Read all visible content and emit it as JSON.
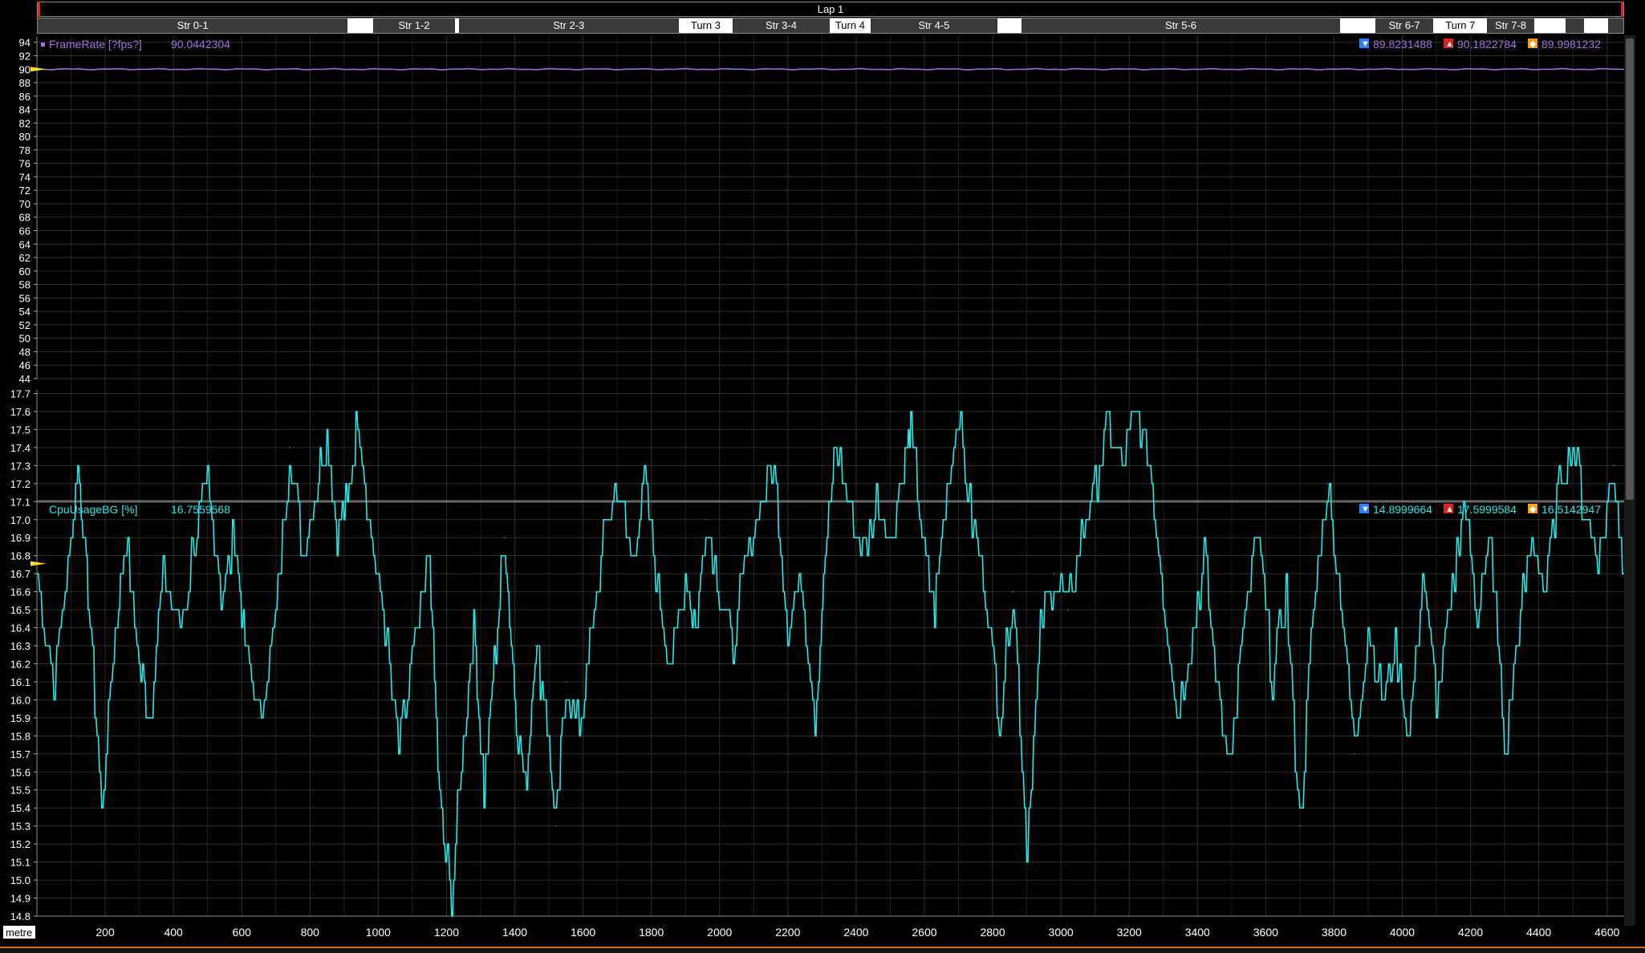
{
  "lap": {
    "title": "Lap 1"
  },
  "sectors": [
    {
      "label": "Str 0-1",
      "start": 0,
      "end": 832,
      "style": "dark"
    },
    {
      "label": "",
      "start": 832,
      "end": 900,
      "style": "light"
    },
    {
      "label": "Str 1-2",
      "start": 900,
      "end": 1120,
      "style": "dark"
    },
    {
      "label": "Str 2-3",
      "start": 1130,
      "end": 1720,
      "style": "dark"
    },
    {
      "label": "Turn 3",
      "start": 1720,
      "end": 1865,
      "style": "light"
    },
    {
      "label": "Str 3-4",
      "start": 1865,
      "end": 2125,
      "style": "dark"
    },
    {
      "label": "Turn 4",
      "start": 2125,
      "end": 2235,
      "style": "light"
    },
    {
      "label": "Str 4-5",
      "start": 2235,
      "end": 2575,
      "style": "dark"
    },
    {
      "label": "",
      "start": 2575,
      "end": 2640,
      "style": "light"
    },
    {
      "label": "Str 5-6",
      "start": 2640,
      "end": 3495,
      "style": "dark"
    },
    {
      "label": "",
      "start": 3495,
      "end": 3590,
      "style": "light"
    },
    {
      "label": "Str 6-7",
      "start": 3590,
      "end": 3745,
      "style": "dark"
    },
    {
      "label": "Turn 7",
      "start": 3745,
      "end": 3890,
      "style": "light"
    },
    {
      "label": "Str 7-8",
      "start": 3890,
      "end": 4015,
      "style": "dark"
    },
    {
      "label": "",
      "start": 4015,
      "end": 4100,
      "style": "light"
    },
    {
      "label": "",
      "start": 4100,
      "end": 4150,
      "style": "dark"
    },
    {
      "label": "",
      "start": 4150,
      "end": 4215,
      "style": "light"
    },
    {
      "label": "",
      "start": 4215,
      "end": 4255,
      "style": "dark"
    }
  ],
  "chart_data": [
    {
      "type": "line",
      "series": [
        {
          "name": "FrameRate [?fps?]",
          "color": "#a070e0"
        }
      ],
      "cursor_value": "90.0442304",
      "stats": {
        "min": "89.8231488",
        "max": "90.1822784",
        "avg": "89.9981232"
      },
      "x_range": [
        0,
        4650
      ],
      "ylim": [
        44,
        94.8
      ],
      "y_ticks": [
        "94",
        "92",
        "90",
        "88",
        "86",
        "84",
        "82",
        "80",
        "78",
        "76",
        "74",
        "72",
        "70",
        "68",
        "66",
        "64",
        "62",
        "60",
        "58",
        "56",
        "54",
        "52",
        "50",
        "48",
        "46",
        "44"
      ],
      "y_level": 90.0,
      "grid": true
    },
    {
      "type": "line",
      "series": [
        {
          "name": "CpuUsageBG [%]",
          "color": "#22e8e8"
        }
      ],
      "cursor_value": "16.7559568",
      "stats": {
        "min": "14.8999664",
        "max": "17.5999584",
        "avg": "16.5142947"
      },
      "x_range": [
        0,
        4650
      ],
      "ylim": [
        14.8,
        17.72
      ],
      "y_ticks": [
        "17.7",
        "17.6",
        "17.5",
        "17.4",
        "17.3",
        "17.2",
        "17.1",
        "17.0",
        "16.9",
        "16.8",
        "16.7",
        "16.6",
        "16.5",
        "16.4",
        "16.3",
        "16.2",
        "16.1",
        "16.0",
        "15.9",
        "15.8",
        "15.7",
        "15.6",
        "15.5",
        "15.4",
        "15.3",
        "15.2",
        "15.1",
        "15.0",
        "14.9",
        "14.8"
      ],
      "points": [
        [
          0,
          16.7
        ],
        [
          50,
          16.1
        ],
        [
          100,
          16.9
        ],
        [
          120,
          17.3
        ],
        [
          150,
          16.6
        ],
        [
          190,
          15.4
        ],
        [
          230,
          16.4
        ],
        [
          260,
          16.9
        ],
        [
          300,
          16.2
        ],
        [
          330,
          15.9
        ],
        [
          370,
          16.7
        ],
        [
          420,
          16.4
        ],
        [
          470,
          17.0
        ],
        [
          500,
          17.2
        ],
        [
          540,
          16.6
        ],
        [
          580,
          16.9
        ],
        [
          610,
          16.3
        ],
        [
          650,
          15.9
        ],
        [
          700,
          16.5
        ],
        [
          740,
          17.4
        ],
        [
          780,
          16.8
        ],
        [
          820,
          17.2
        ],
        [
          850,
          17.5
        ],
        [
          880,
          16.9
        ],
        [
          910,
          17.1
        ],
        [
          940,
          17.6
        ],
        [
          980,
          16.9
        ],
        [
          1020,
          16.4
        ],
        [
          1060,
          15.7
        ],
        [
          1100,
          16.2
        ],
        [
          1150,
          16.8
        ],
        [
          1180,
          15.4
        ],
        [
          1215,
          14.9
        ],
        [
          1250,
          15.8
        ],
        [
          1280,
          16.4
        ],
        [
          1310,
          15.5
        ],
        [
          1340,
          16.2
        ],
        [
          1370,
          16.9
        ],
        [
          1400,
          16.0
        ],
        [
          1430,
          15.5
        ],
        [
          1460,
          16.3
        ],
        [
          1490,
          16.0
        ],
        [
          1520,
          15.3
        ],
        [
          1550,
          16.1
        ],
        [
          1590,
          15.8
        ],
        [
          1620,
          16.3
        ],
        [
          1660,
          16.9
        ],
        [
          1700,
          17.2
        ],
        [
          1740,
          16.8
        ],
        [
          1780,
          17.2
        ],
        [
          1820,
          16.6
        ],
        [
          1860,
          16.2
        ],
        [
          1900,
          16.7
        ],
        [
          1930,
          16.4
        ],
        [
          1960,
          17.0
        ],
        [
          2000,
          16.6
        ],
        [
          2040,
          16.3
        ],
        [
          2080,
          16.8
        ],
        [
          2120,
          17.1
        ],
        [
          2160,
          17.3
        ],
        [
          2200,
          16.4
        ],
        [
          2240,
          16.7
        ],
        [
          2280,
          15.9
        ],
        [
          2310,
          16.8
        ],
        [
          2340,
          17.4
        ],
        [
          2380,
          17.1
        ],
        [
          2420,
          16.8
        ],
        [
          2460,
          17.1
        ],
        [
          2500,
          16.9
        ],
        [
          2540,
          17.3
        ],
        [
          2560,
          17.5
        ],
        [
          2600,
          16.8
        ],
        [
          2630,
          16.5
        ],
        [
          2660,
          17.1
        ],
        [
          2700,
          17.6
        ],
        [
          2740,
          17.0
        ],
        [
          2780,
          16.6
        ],
        [
          2820,
          15.9
        ],
        [
          2860,
          16.6
        ],
        [
          2900,
          15.2
        ],
        [
          2940,
          16.4
        ],
        [
          2980,
          16.7
        ],
        [
          3020,
          16.5
        ],
        [
          3060,
          16.9
        ],
        [
          3100,
          17.2
        ],
        [
          3140,
          17.5
        ],
        [
          3180,
          17.3
        ],
        [
          3220,
          17.6
        ],
        [
          3260,
          17.3
        ],
        [
          3300,
          16.6
        ],
        [
          3340,
          15.9
        ],
        [
          3380,
          16.3
        ],
        [
          3420,
          16.8
        ],
        [
          3460,
          16.0
        ],
        [
          3500,
          15.7
        ],
        [
          3540,
          16.5
        ],
        [
          3580,
          16.9
        ],
        [
          3620,
          16.1
        ],
        [
          3660,
          16.6
        ],
        [
          3700,
          15.3
        ],
        [
          3740,
          16.5
        ],
        [
          3780,
          17.2
        ],
        [
          3820,
          16.6
        ],
        [
          3860,
          15.7
        ],
        [
          3900,
          16.4
        ],
        [
          3940,
          16.0
        ],
        [
          3980,
          16.3
        ],
        [
          4020,
          15.8
        ],
        [
          4060,
          16.7
        ],
        [
          4100,
          16.0
        ],
        [
          4140,
          16.5
        ],
        [
          4180,
          17.1
        ],
        [
          4220,
          16.5
        ],
        [
          4260,
          16.9
        ],
        [
          4300,
          15.7
        ],
        [
          4340,
          16.4
        ],
        [
          4380,
          16.9
        ],
        [
          4420,
          16.6
        ],
        [
          4460,
          17.2
        ],
        [
          4500,
          17.4
        ],
        [
          4540,
          17.0
        ],
        [
          4580,
          16.8
        ],
        [
          4620,
          17.3
        ],
        [
          4650,
          16.7
        ]
      ],
      "grid": true
    }
  ],
  "x_axis": {
    "unit_label": "metre",
    "ticks": [
      "200",
      "400",
      "600",
      "800",
      "1000",
      "1200",
      "1400",
      "1600",
      "1800",
      "2000",
      "2200",
      "2400",
      "2600",
      "2800",
      "3000",
      "3200",
      "3400",
      "3600",
      "3800",
      "4000",
      "4200",
      "4400",
      "4600"
    ],
    "tick_values": [
      200,
      400,
      600,
      800,
      1000,
      1200,
      1400,
      1600,
      1800,
      2000,
      2200,
      2400,
      2600,
      2800,
      3000,
      3200,
      3400,
      3600,
      3800,
      4000,
      4200,
      4400,
      4600
    ],
    "range": [
      0,
      4650
    ]
  },
  "colors": {
    "grid": "#2e2e2e",
    "framerate": "#a070e0",
    "cpu": "#22e8e8",
    "cursor": "#f0e020",
    "min_icon": "#2a7fff",
    "max_icon": "#e02020",
    "avg_icon": "#ff9a20"
  }
}
